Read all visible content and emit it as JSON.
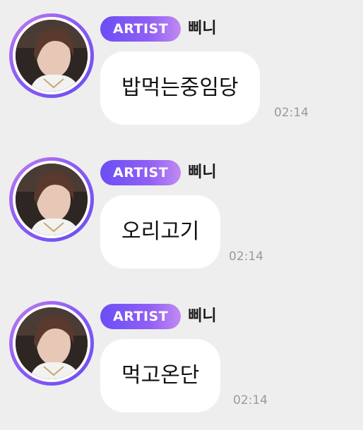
{
  "messages": [
    {
      "badge": "ARTIST",
      "sender": "삐니",
      "text": "밥먹는중임당",
      "time": "02:14"
    },
    {
      "badge": "ARTIST",
      "sender": "삐니",
      "text": "오리고기",
      "time": "02:14"
    },
    {
      "badge": "ARTIST",
      "sender": "삐니",
      "text": "먹고온단",
      "time": "02:14"
    }
  ],
  "colors": {
    "background": "#eeeeee",
    "badge_gradient_start": "#6b4ef5",
    "badge_gradient_end": "#c18af2",
    "avatar_ring": "#8a5cf5",
    "bubble": "#ffffff",
    "time_text": "#9a9a9a"
  }
}
